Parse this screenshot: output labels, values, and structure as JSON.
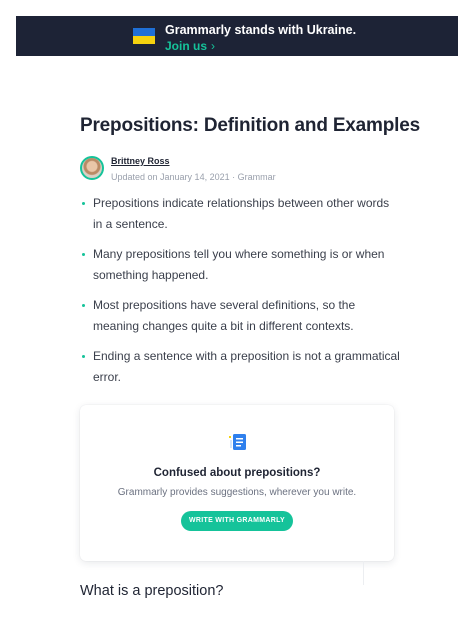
{
  "banner": {
    "title": "Grammarly stands with Ukraine.",
    "link_label": "Join us",
    "chevron": "›",
    "flag_colors": [
      "#1f6fd6",
      "#f5d20f"
    ]
  },
  "article": {
    "title": "Prepositions: Definition and Examples",
    "author": "Brittney Ross",
    "updated": "Updated on January 14, 2021 · ",
    "category": "Grammar",
    "bullets": [
      "Prepositions indicate relationships between other words in a sentence.",
      "Many prepositions tell you where something is or when something happened.",
      "Most prepositions have several definitions, so the meaning changes quite a bit in different contexts.",
      "Ending a sentence with a preposition is not a grammatical error."
    ],
    "section_heading": "What is a preposition?"
  },
  "promo": {
    "icon": "document-icon",
    "title": "Confused about prepositions?",
    "subtitle": "Grammarly provides suggestions, wherever you write.",
    "button_label": "WRITE WITH GRAMMARLY"
  },
  "colors": {
    "accent": "#15c39a",
    "banner_bg": "#1d2336",
    "text": "#1f2433"
  }
}
